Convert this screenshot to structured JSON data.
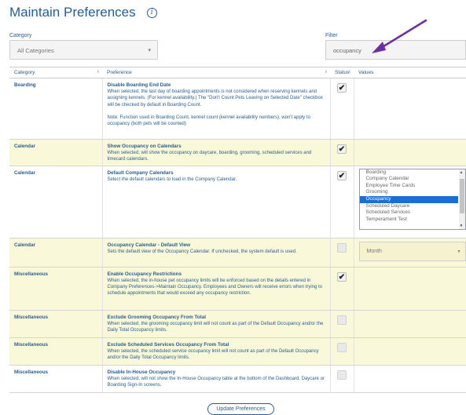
{
  "page": {
    "title": "Maintain Preferences",
    "info_icon": "info-icon"
  },
  "category_filter": {
    "label": "Category",
    "value": "All Categories"
  },
  "filter": {
    "label": "Filter",
    "value": "occupancy"
  },
  "table": {
    "headers": {
      "category": "Category",
      "preference": "Preference",
      "status": "Status",
      "values": "Values"
    },
    "rows": [
      {
        "category": "Boarding",
        "title": "Disable Boarding End Date",
        "description": "When selected, the last day of boarding appointments is not considered when reserving kennels and assigning kennels. (For kennel availability.) The \"Don't Count Pets Leaving on Selected Date\" checkbox will be checked by default in Boarding Count.",
        "note": "Note: Function used in Boarding Count, kennel count (kennel availability numbers), won't apply to occupancy (both pets will be counted)",
        "checked": true,
        "highlighted": false
      },
      {
        "category": "Calendar",
        "title": "Show Occupancy on Calendars",
        "description": "When selected, will show the occupancy on daycare, boarding, grooming, scheduled services and timecard calendars.",
        "checked": true,
        "highlighted": true
      },
      {
        "category": "Calendar",
        "title": "Default Company Calendars",
        "description": "Select the default calendars to load in the Company Calendar.",
        "checked": true,
        "highlighted": false,
        "calendar_options": [
          "Boarding",
          "Company Calendar",
          "Employee Time Cards",
          "Grooming",
          "Occupancy",
          "Scheduled Daycare",
          "Scheduled Services",
          "Temperament Test"
        ],
        "calendar_selected": "Occupancy"
      },
      {
        "category": "Calendar",
        "title": "Occupancy Calendar - Default View",
        "description": "Sets the default view of the Occupancy Calendar. If unchecked, the system default is used.",
        "checked": false,
        "highlighted": true,
        "view_value": "Month"
      },
      {
        "category": "Miscellaneous",
        "title": "Enable Occupancy Restrictions",
        "description": "When selected, the in-house pet occupancy limits will be enforced based on the details entered in Company Preferences->Maintain Occupancy. Employees and Owners will receive errors when trying to schedule appointments that would exceed any occupancy restriction.",
        "checked": true,
        "highlighted": true
      },
      {
        "category": "Miscellaneous",
        "title": "Exclude Grooming Occupancy From Total",
        "description": "When selected, the grooming occupancy limit will not count as part of the Default Occupancy and/or the Daily Total Occupancy limits.",
        "checked": false,
        "highlighted": true
      },
      {
        "category": "Miscellaneous",
        "title": "Exclude Scheduled Services Occupancy From Total",
        "description": "When selected, the scheduled service occupancy limit will not count as part of the Default Occupancy and/or the Daily Total Occupancy limits.",
        "checked": false,
        "highlighted": true
      },
      {
        "category": "Miscellaneous",
        "title": "Disable In-House Occupancy",
        "description": "When selected, will not show the In-House Occupancy table at the bottom of the Dashboard, Daycare or Boarding Sign-In screens.",
        "checked": false,
        "highlighted": false
      }
    ]
  },
  "actions": {
    "update": "Update Preferences"
  },
  "colors": {
    "accent": "#2a5d8f",
    "highlight": "#f9f8d9",
    "arrow": "#6b2fa0",
    "selected": "#1a6fd6"
  }
}
